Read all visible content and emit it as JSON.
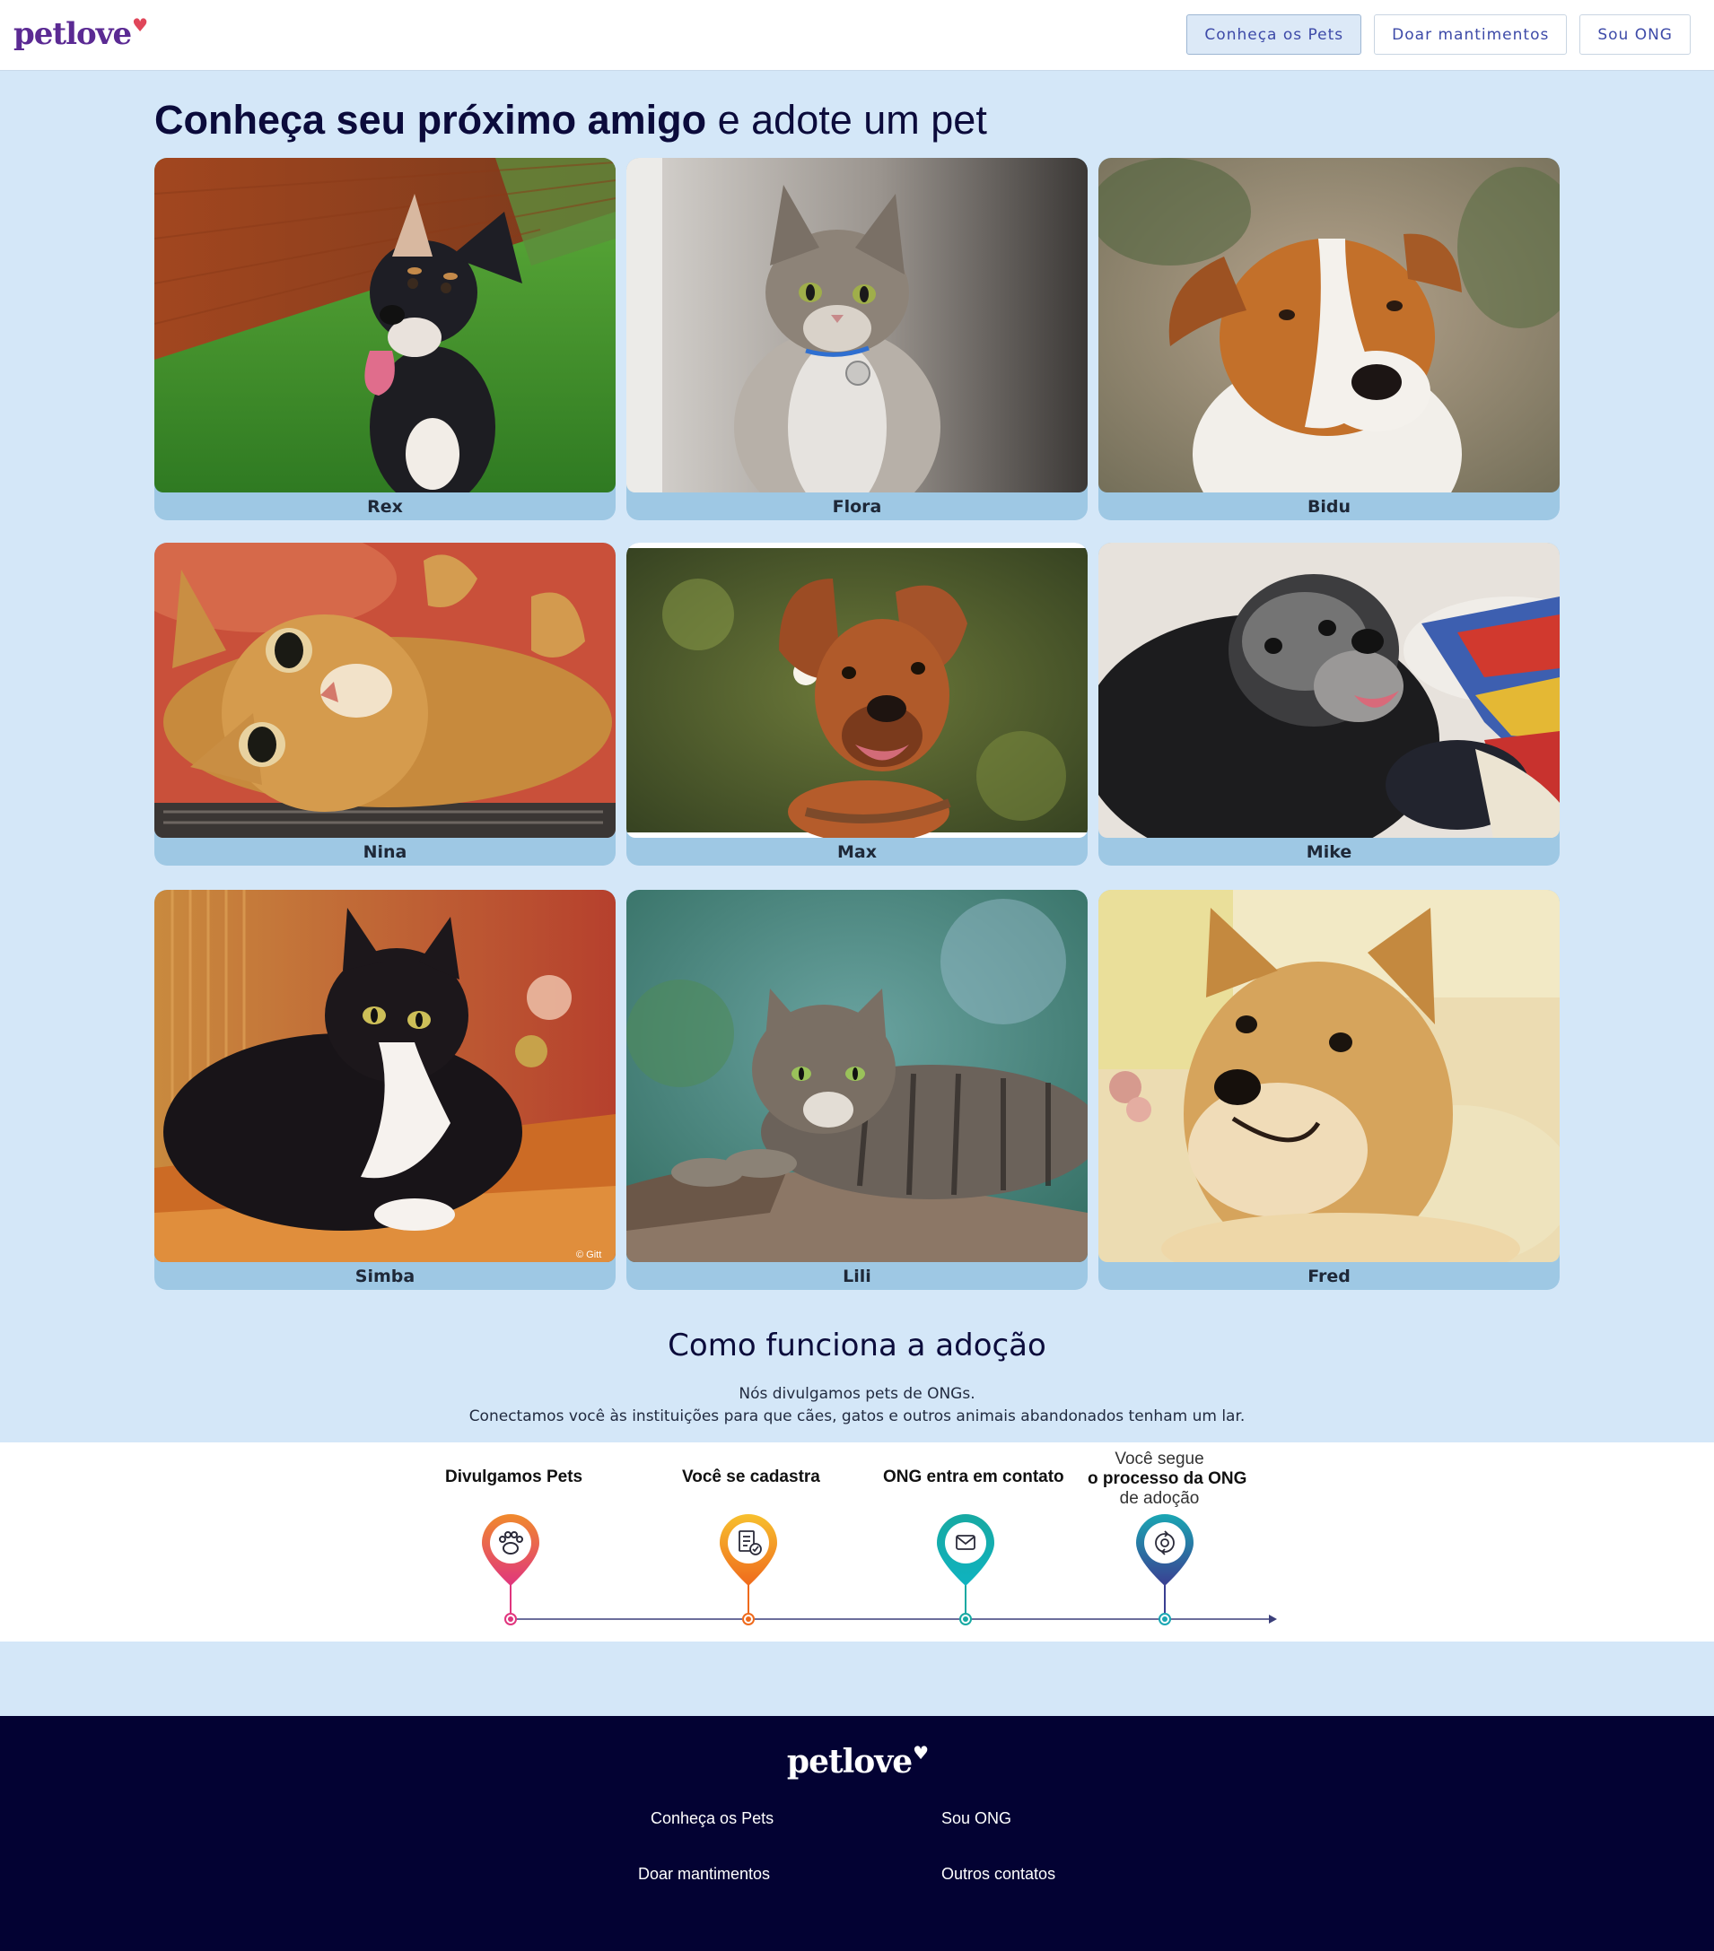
{
  "header": {
    "logo": "petlove",
    "nav": [
      "Conheça os Pets",
      "Doar mantimentos",
      "Sou ONG"
    ]
  },
  "hero": {
    "title_bold": "Conheça seu próximo amigo",
    "title_rest": " e adote um pet"
  },
  "pets": [
    {
      "name": "Rex"
    },
    {
      "name": "Flora"
    },
    {
      "name": "Bidu"
    },
    {
      "name": "Nina"
    },
    {
      "name": "Max"
    },
    {
      "name": "Mike"
    },
    {
      "name": "Simba"
    },
    {
      "name": "Lili"
    },
    {
      "name": "Fred"
    }
  ],
  "photo_watermark": "© Gitt",
  "how": {
    "title": "Como funciona a adoção",
    "line1": "Nós divulgamos pets de ONGs.",
    "line2": "Conectamos você às instituições para que cães, gatos e outros animais abandonados tenham um lar.",
    "steps": [
      {
        "label": "Divulgamos Pets",
        "icon": "paw-icon",
        "color": "#e0357e"
      },
      {
        "label": "Você se cadastra",
        "icon": "form-check-icon",
        "color": "#f28a1e"
      },
      {
        "label": "ONG entra em contato",
        "icon": "envelope-icon",
        "color": "#17a9a2"
      },
      {
        "label_top": "Você segue",
        "label_mid": "o processo da ONG",
        "label_bot": "de adoção",
        "icon": "cycle-icon",
        "color": "#3a3f92"
      }
    ]
  },
  "footer": {
    "logo": "petlove",
    "links": [
      "Conheça os Pets",
      "Sou ONG",
      "Doar mantimentos",
      "Outros contatos"
    ]
  }
}
